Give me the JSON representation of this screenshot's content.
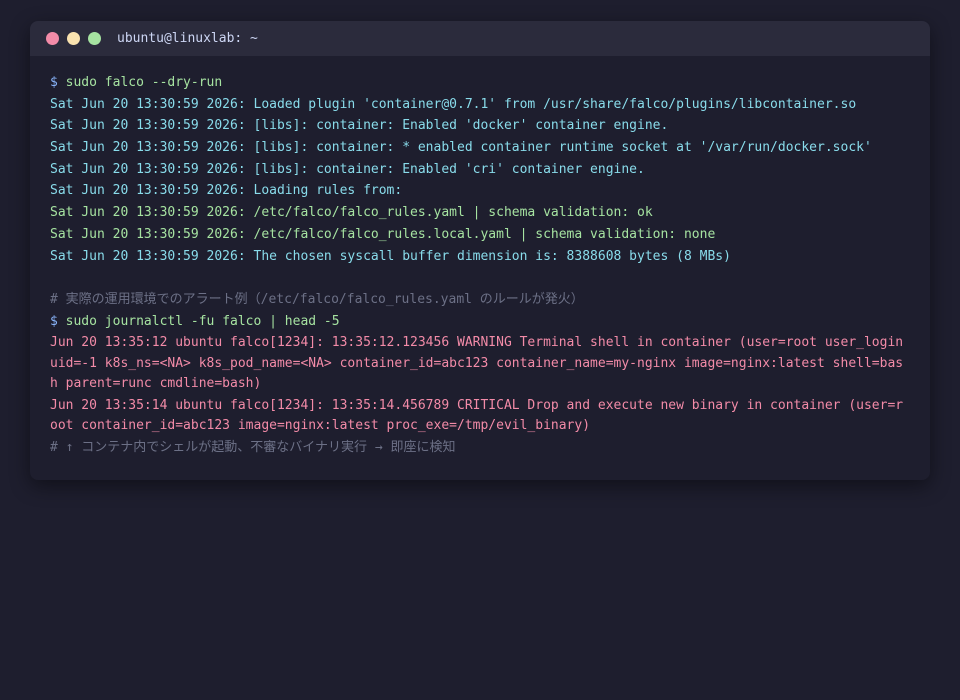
{
  "window": {
    "title": "ubuntu@linuxlab: ~",
    "controls": [
      {
        "name": "close",
        "color": "#f38ba8"
      },
      {
        "name": "minimize",
        "color": "#f9e2af"
      },
      {
        "name": "maximize",
        "color": "#a6e3a1"
      }
    ]
  },
  "terminal": {
    "prompt_symbol": "$",
    "comment_symbol": "#",
    "command1": "sudo falco --dry-run",
    "output1": [
      "Sat Jun 20 13:30:59 2026: Loaded plugin 'container@0.7.1' from /usr/share/falco/plugins/libcontainer.so",
      "Sat Jun 20 13:30:59 2026: [libs]: container: Enabled 'docker' container engine.",
      "Sat Jun 20 13:30:59 2026: [libs]: container: * enabled container runtime socket at '/var/run/docker.sock'",
      "Sat Jun 20 13:30:59 2026: [libs]: container: Enabled 'cri' container engine.",
      "Sat Jun 20 13:30:59 2026: Loading rules from:",
      "Sat Jun 20 13:30:59 2026: /etc/falco/falco_rules.yaml | schema validation: ok",
      "Sat Jun 20 13:30:59 2026: /etc/falco/falco_rules.local.yaml | schema validation: none",
      "Sat Jun 20 13:30:59 2026: The chosen syscall buffer dimension is: 8388608 bytes (8 MBs)"
    ],
    "comment1": "実際の運用環境でのアラート例（/etc/falco/falco_rules.yaml のルールが発火）",
    "command2": "sudo journalctl -fu falco | head -5",
    "alerts": [
      "Jun 20 13:35:12 ubuntu falco[1234]: 13:35:12.123456 WARNING Terminal shell in container (user=root user_loginuid=-1 k8s_ns=<NA> k8s_pod_name=<NA> container_id=abc123 container_name=my-nginx image=nginx:latest shell=bash parent=runc cmdline=bash)",
      "Jun 20 13:35:14 ubuntu falco[1234]: 13:35:14.456789 CRITICAL Drop and execute new binary in container (user=root container_id=abc123 image=nginx:latest proc_exe=/tmp/evil_binary)"
    ],
    "comment2": "↑ コンテナ内でシェルが起動、不審なバイナリ実行 → 即座に検知"
  },
  "colors": {
    "background": "#1e1e2e",
    "titlebar": "#2b2b3c",
    "prompt": "#89b4fa",
    "command": "#a6e3a1",
    "info": "#89dceb",
    "success": "#a6e3a1",
    "alert": "#f38ba8",
    "comment": "#6c7086"
  }
}
